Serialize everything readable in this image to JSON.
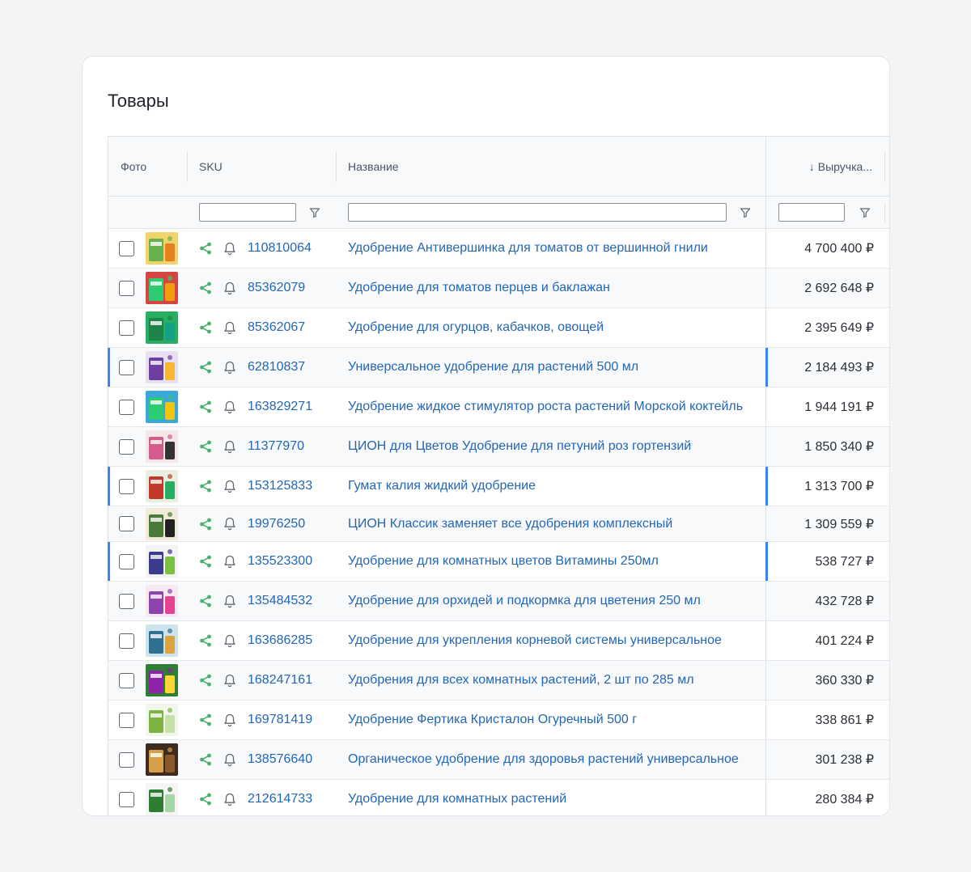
{
  "page": {
    "title": "Товары"
  },
  "columns": {
    "foto": "Фото",
    "sku": "SKU",
    "name": "Название",
    "revenue": "Выручка...",
    "sort_arrow": "↓"
  },
  "colors": {
    "link": "#2366b5",
    "share_icon": "#4caf6e",
    "highlight": "#3b82f6"
  },
  "rows": [
    {
      "sku": "110810064",
      "name": "Удобрение Антивершинка для томатов от вершинной гнили",
      "revenue": "4 700 400 ₽",
      "highlighted": false,
      "thumb": [
        "#f2d36b",
        "#6ab04c",
        "#e67e22"
      ]
    },
    {
      "sku": "85362079",
      "name": "Удобрение для томатов перцев и баклажан",
      "revenue": "2 692 648 ₽",
      "highlighted": false,
      "thumb": [
        "#d64541",
        "#2ecc71",
        "#f39c12"
      ]
    },
    {
      "sku": "85362067",
      "name": "Удобрение для огурцов, кабачков, овощей",
      "revenue": "2 395 649 ₽",
      "highlighted": false,
      "thumb": [
        "#27ae60",
        "#1e8449",
        "#16a085"
      ]
    },
    {
      "sku": "62810837",
      "name": "Универсальное удобрение для растений 500 мл",
      "revenue": "2 184 493 ₽",
      "highlighted": true,
      "thumb": [
        "#e8e0f0",
        "#6c3fa0",
        "#f7b731"
      ]
    },
    {
      "sku": "163829271",
      "name": "Удобрение жидкое стимулятор роста растений Морской коктейль",
      "revenue": "1 944 191 ₽",
      "highlighted": false,
      "thumb": [
        "#3aa6d9",
        "#2ecc71",
        "#f1c40f"
      ]
    },
    {
      "sku": "11377970",
      "name": "ЦИОН для Цветов Удобрение для петуний роз гортензий",
      "revenue": "1 850 340 ₽",
      "highlighted": false,
      "thumb": [
        "#f5e6e8",
        "#d35d8a",
        "#333333"
      ]
    },
    {
      "sku": "153125833",
      "name": "Гумат калия жидкий удобрение",
      "revenue": "1 313 700 ₽",
      "highlighted": true,
      "thumb": [
        "#e8efe0",
        "#c0392b",
        "#27ae60"
      ]
    },
    {
      "sku": "19976250",
      "name": "ЦИОН Классик заменяет все удобрения комплексный",
      "revenue": "1 309 559 ₽",
      "highlighted": false,
      "thumb": [
        "#f0ead8",
        "#4a7a3a",
        "#222222"
      ]
    },
    {
      "sku": "135523300",
      "name": "Удобрение для комнатных цветов Витамины 250мл",
      "revenue": "538 727 ₽",
      "highlighted": true,
      "thumb": [
        "#f4f4f4",
        "#3b3b8f",
        "#7bc043"
      ]
    },
    {
      "sku": "135484532",
      "name": "Удобрение для орхидей и подкормка для цветения 250 мл",
      "revenue": "432 728 ₽",
      "highlighted": false,
      "thumb": [
        "#f6e9f2",
        "#8e44ad",
        "#e84393"
      ]
    },
    {
      "sku": "163686285",
      "name": "Удобрение для укрепления корневой системы универсальное",
      "revenue": "401 224 ₽",
      "highlighted": false,
      "thumb": [
        "#cfe3ec",
        "#2f6f8f",
        "#d9a441"
      ]
    },
    {
      "sku": "168247161",
      "name": "Удобрения для всех комнатных растений, 2 шт по 285 мл",
      "revenue": "360 330 ₽",
      "highlighted": false,
      "thumb": [
        "#2e7d32",
        "#8e24aa",
        "#fdd835"
      ]
    },
    {
      "sku": "169781419",
      "name": "Удобрение Фертика Кристалон Огуречный 500 г",
      "revenue": "338 861 ₽",
      "highlighted": false,
      "thumb": [
        "#f2f7ee",
        "#7cb342",
        "#c5e1a5"
      ]
    },
    {
      "sku": "138576640",
      "name": "Органическое удобрение для здоровья растений универсальное",
      "revenue": "301 238 ₽",
      "highlighted": false,
      "thumb": [
        "#3e2a1e",
        "#d4a04a",
        "#8a5a2b"
      ]
    },
    {
      "sku": "212614733",
      "name": "Удобрение для комнатных растений",
      "revenue": "280 384 ₽",
      "highlighted": false,
      "thumb": [
        "#f5f5f5",
        "#2e7d32",
        "#a5d6a7"
      ]
    }
  ]
}
